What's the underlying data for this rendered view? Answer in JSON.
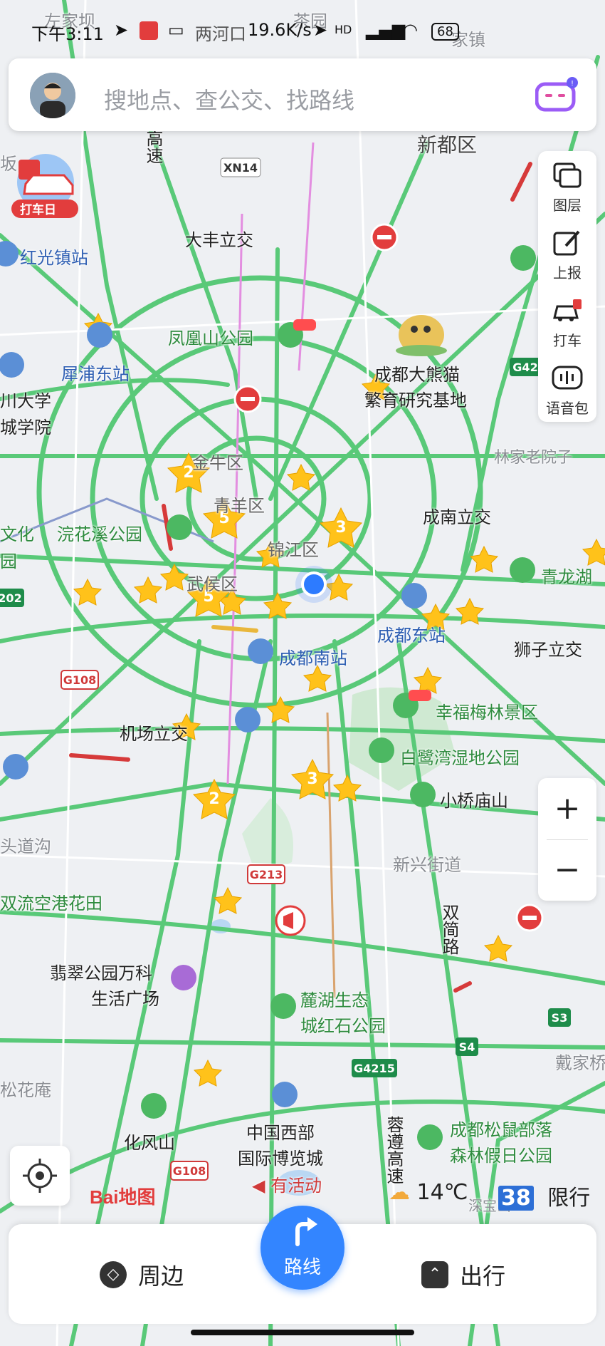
{
  "status_bar": {
    "time": "下午3:11",
    "network_speed": "19.6K/s",
    "signal": "4G",
    "battery": "68"
  },
  "search": {
    "placeholder": "搜地点、查公交、找路线"
  },
  "promo": {
    "label": "打车日"
  },
  "tools": [
    {
      "label": "图层",
      "icon": "layers-icon"
    },
    {
      "label": "上报",
      "icon": "report-icon"
    },
    {
      "label": "打车",
      "icon": "taxi-icon"
    },
    {
      "label": "语音包",
      "icon": "voice-pack-icon"
    }
  ],
  "zoom": {
    "in": "+",
    "out": "−"
  },
  "map": {
    "labels": {
      "zuojiaba": "左家坝",
      "chayuan": "茶园",
      "lianghekou": "两河口",
      "jiazhen": "家镇",
      "xindu": "新都区",
      "ban": "坂",
      "xn14": "XN14",
      "dafeng": "大丰立交",
      "hongguang": "红光镇站",
      "fenghuangshan": "凤凰山公园",
      "xipu": "犀浦东站",
      "university1": "川大学",
      "university2": "城学院",
      "panda1": "成都大熊猫",
      "panda2": "繁育研究基地",
      "g42": "G42",
      "linjialao": "林家老院子",
      "jinniu": "金牛区",
      "qingyang": "青羊区",
      "jinjiang": "锦江区",
      "wuhou": "武侯区",
      "wenhua": "文化",
      "yuan": "园",
      "huanhuaxi": "浣花溪公园",
      "chengnan": "成南立交",
      "qinglonghu": "青龙湖",
      "g202": "202",
      "chengdudong": "成都东站",
      "shizi": "狮子立交",
      "chengdunan": "成都南站",
      "g108_top": "G108",
      "xingfu": "幸福梅林景区",
      "jichang": "机场立交",
      "bailu": "白鹭湾湿地公园",
      "xiaoqiao": "小桥庙山",
      "toudao": "头道沟",
      "xinxing": "新兴街道",
      "shuangliu": "双流空港花田",
      "g213": "G213",
      "shuangjian1": "双",
      "shuangjian2": "简",
      "shuangjian3": "路",
      "feicui1": "翡翠公园万科",
      "feicui2": "生活广场",
      "luhu1": "麓湖生态",
      "luhu2": "城红石公园",
      "s3": "S3",
      "s4": "S4",
      "g4215": "G4215",
      "daijia": "戴家桥",
      "songhua": "松花庵",
      "huafeng": "化风山",
      "museum1": "中国西部",
      "museum2": "国际博览城",
      "activity": "有活动",
      "rongzun1": "蓉",
      "rongzun2": "遵",
      "rongzun3": "高",
      "rongzun4": "速",
      "songshu1": "成都松鼠部落",
      "songshu2": "森林假日公园",
      "g108_bottom": "G108",
      "shenbao": "深宝山",
      "gao": "高",
      "su": "速"
    },
    "clusters": [
      "2",
      "5",
      "3",
      "5",
      "2",
      "3"
    ],
    "logo": "Bai地图"
  },
  "weather": {
    "temperature": "14℃",
    "restriction_numbers": "38",
    "restriction_label": "限行"
  },
  "bottom": {
    "nearby": "周边",
    "route": "路线",
    "travel": "出行"
  }
}
